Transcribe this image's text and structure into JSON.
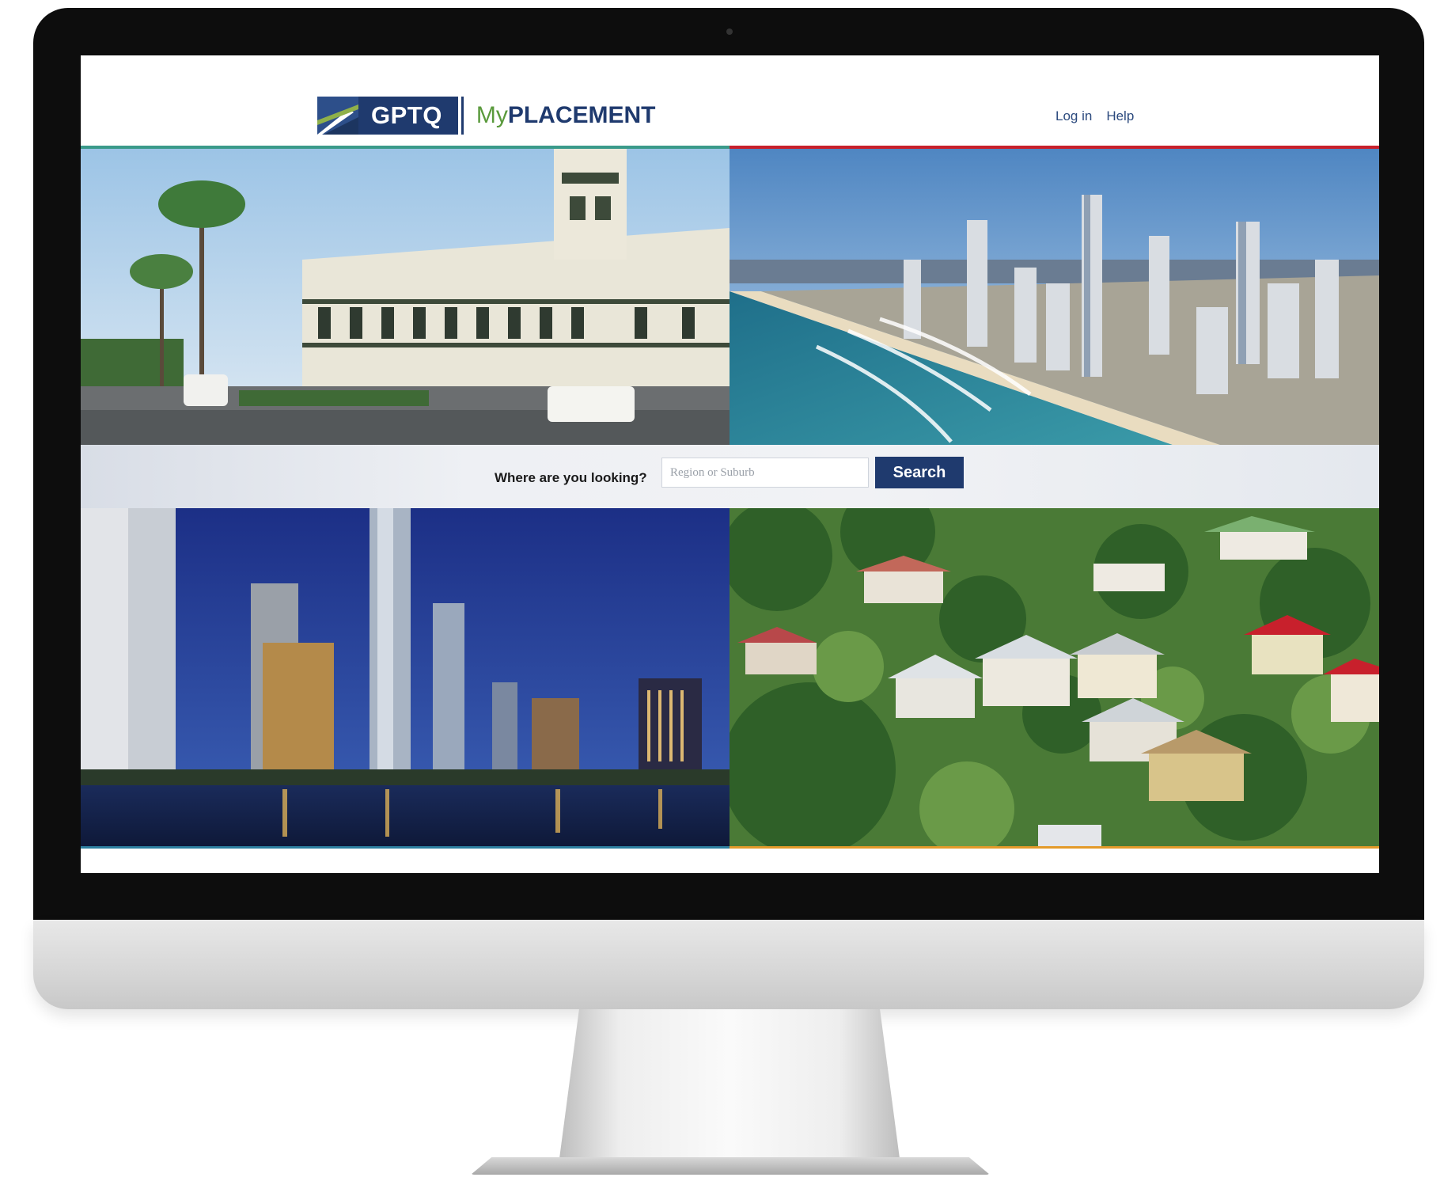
{
  "brand": {
    "logo_box_text": "GPTQ",
    "logo_my": "My",
    "logo_placement": "PLACEMENT",
    "primary_color": "#1f3a6e",
    "accent_green": "#5a9a3c"
  },
  "nav": {
    "login_label": "Log in",
    "help_label": "Help"
  },
  "search": {
    "prompt": "Where are you looking?",
    "placeholder": "Region or Suburb",
    "value": "",
    "button_label": "Search"
  },
  "photos": [
    {
      "subject": "heritage-hotel-street-photo"
    },
    {
      "subject": "coastal-skyline-beach-photo"
    },
    {
      "subject": "night-city-skyline-river-photo"
    },
    {
      "subject": "hillside-houses-photo"
    }
  ],
  "accent_colors": {
    "rule_top_left": "#3a9a8a",
    "rule_top_right": "#c8202c",
    "rule_bottom_left": "#2d7fa0",
    "rule_bottom_right": "#e39a2a"
  }
}
